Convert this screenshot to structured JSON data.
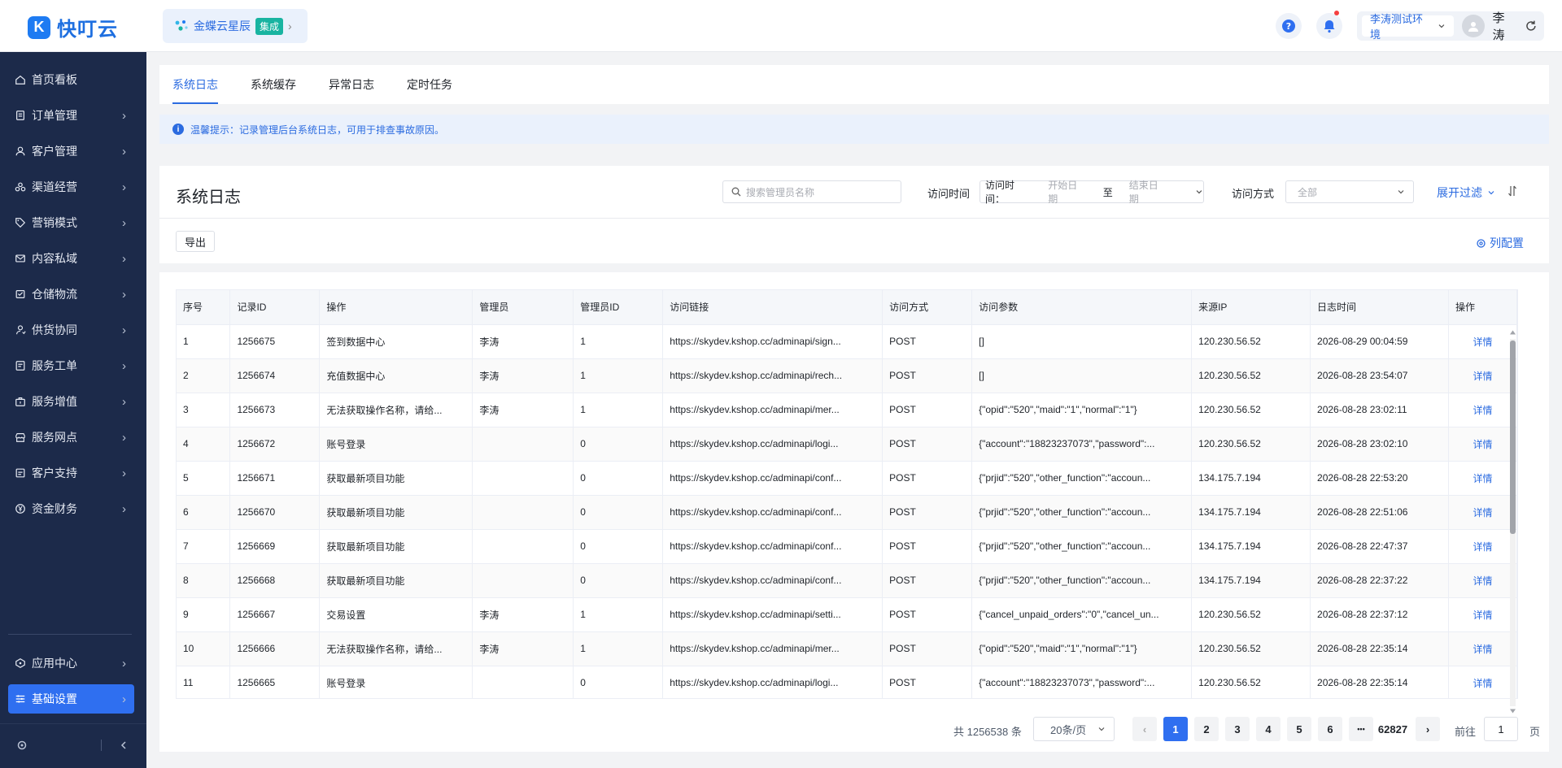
{
  "app": {
    "logo_text": "快叮云",
    "brand_name": "金蝶云星辰",
    "brand_tag": "集成"
  },
  "header": {
    "environment": "李涛测试环境",
    "user_name": "李涛"
  },
  "sidebar": {
    "items": [
      {
        "label": "首页看板",
        "icon": "home-icon"
      },
      {
        "label": "订单管理",
        "icon": "order-icon"
      },
      {
        "label": "客户管理",
        "icon": "user-icon"
      },
      {
        "label": "渠道经营",
        "icon": "channel-icon"
      },
      {
        "label": "营销模式",
        "icon": "tag-icon"
      },
      {
        "label": "内容私域",
        "icon": "mail-icon"
      },
      {
        "label": "仓储物流",
        "icon": "warehouse-icon"
      },
      {
        "label": "供货协同",
        "icon": "supply-icon"
      },
      {
        "label": "服务工单",
        "icon": "ticket-icon"
      },
      {
        "label": "服务增值",
        "icon": "briefcase-icon"
      },
      {
        "label": "服务网点",
        "icon": "store-icon"
      },
      {
        "label": "客户支持",
        "icon": "support-icon"
      },
      {
        "label": "资金财务",
        "icon": "yen-icon"
      }
    ],
    "bottom_items": [
      {
        "label": "应用中心",
        "icon": "app-icon"
      },
      {
        "label": "基础设置",
        "icon": "settings-icon"
      }
    ]
  },
  "tabs": [
    "系统日志",
    "系统缓存",
    "异常日志",
    "定时任务"
  ],
  "tip": "温馨提示：记录管理后台系统日志，可用于排查事故原因。",
  "filter": {
    "page_title": "系统日志",
    "search_placeholder": "搜索管理员名称",
    "visit_time_label": "访问时间",
    "date_prefix": "访问时间：",
    "start_placeholder": "开始日期",
    "date_separator": "至",
    "end_placeholder": "结束日期",
    "method_label": "访问方式",
    "method_value": "全部",
    "expand_label": "展开过滤",
    "export_label": "导出",
    "columns_label": "列配置"
  },
  "table": {
    "columns": [
      "序号",
      "记录ID",
      "操作",
      "管理员",
      "管理员ID",
      "访问链接",
      "访问方式",
      "访问参数",
      "来源IP",
      "日志时间",
      "操作"
    ],
    "action_label": "详情",
    "rows": [
      [
        "1",
        "1256675",
        "签到数据中心",
        "李涛",
        "1",
        "https://skydev.kshop.cc/adminapi/sign...",
        "POST",
        "[]",
        "120.230.56.52",
        "2026-08-29 00:04:59"
      ],
      [
        "2",
        "1256674",
        "充值数据中心",
        "李涛",
        "1",
        "https://skydev.kshop.cc/adminapi/rech...",
        "POST",
        "[]",
        "120.230.56.52",
        "2026-08-28 23:54:07"
      ],
      [
        "3",
        "1256673",
        "无法获取操作名称，请给...",
        "李涛",
        "1",
        "https://skydev.kshop.cc/adminapi/mer...",
        "POST",
        "{\"opid\":\"520\",\"maid\":\"1\",\"normal\":\"1\"}",
        "120.230.56.52",
        "2026-08-28 23:02:11"
      ],
      [
        "4",
        "1256672",
        "账号登录",
        "",
        "0",
        "https://skydev.kshop.cc/adminapi/logi...",
        "POST",
        "{\"account\":\"18823237073\",\"password\":...",
        "120.230.56.52",
        "2026-08-28 23:02:10"
      ],
      [
        "5",
        "1256671",
        "获取最新项目功能",
        "",
        "0",
        "https://skydev.kshop.cc/adminapi/conf...",
        "POST",
        "{\"prjid\":\"520\",\"other_function\":\"accoun...",
        "134.175.7.194",
        "2026-08-28 22:53:20"
      ],
      [
        "6",
        "1256670",
        "获取最新项目功能",
        "",
        "0",
        "https://skydev.kshop.cc/adminapi/conf...",
        "POST",
        "{\"prjid\":\"520\",\"other_function\":\"accoun...",
        "134.175.7.194",
        "2026-08-28 22:51:06"
      ],
      [
        "7",
        "1256669",
        "获取最新项目功能",
        "",
        "0",
        "https://skydev.kshop.cc/adminapi/conf...",
        "POST",
        "{\"prjid\":\"520\",\"other_function\":\"accoun...",
        "134.175.7.194",
        "2026-08-28 22:47:37"
      ],
      [
        "8",
        "1256668",
        "获取最新项目功能",
        "",
        "0",
        "https://skydev.kshop.cc/adminapi/conf...",
        "POST",
        "{\"prjid\":\"520\",\"other_function\":\"accoun...",
        "134.175.7.194",
        "2026-08-28 22:37:22"
      ],
      [
        "9",
        "1256667",
        "交易设置",
        "李涛",
        "1",
        "https://skydev.kshop.cc/adminapi/setti...",
        "POST",
        "{\"cancel_unpaid_orders\":\"0\",\"cancel_un...",
        "120.230.56.52",
        "2026-08-28 22:37:12"
      ],
      [
        "10",
        "1256666",
        "无法获取操作名称，请给...",
        "李涛",
        "1",
        "https://skydev.kshop.cc/adminapi/mer...",
        "POST",
        "{\"opid\":\"520\",\"maid\":\"1\",\"normal\":\"1\"}",
        "120.230.56.52",
        "2026-08-28 22:35:14"
      ],
      [
        "11",
        "1256665",
        "账号登录",
        "",
        "0",
        "https://skydev.kshop.cc/adminapi/logi...",
        "POST",
        "{\"account\":\"18823237073\",\"password\":...",
        "120.230.56.52",
        "2026-08-28 22:35:14"
      ]
    ]
  },
  "pagination": {
    "total_text": "共 1256538 条",
    "page_size": "20条/页",
    "pages": [
      "1",
      "2",
      "3",
      "4",
      "5",
      "6"
    ],
    "ellipsis": "•••",
    "last_page": "62827",
    "current_page": "1",
    "goto_label": "前往",
    "goto_value": "1",
    "page_unit": "页"
  },
  "colors": {
    "primary": "#2f6ff0",
    "sidebar_bg": "#1c2a4a",
    "link": "#2b6be0"
  }
}
